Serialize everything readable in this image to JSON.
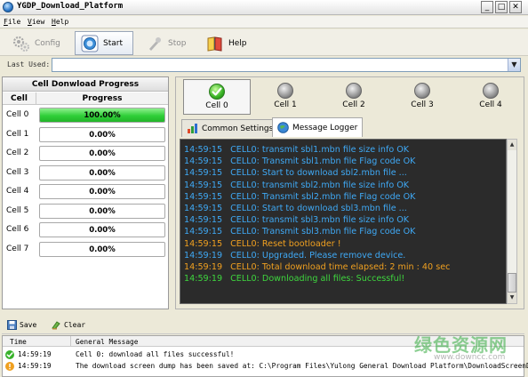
{
  "window": {
    "title": "YGDP_Download_Platform",
    "controls": [
      "_",
      "□",
      "✕"
    ]
  },
  "menu": [
    {
      "label": "File",
      "u": "F",
      "rest": "ile"
    },
    {
      "label": "View",
      "u": "V",
      "rest": "iew"
    },
    {
      "label": "Help",
      "u": "H",
      "rest": "elp"
    }
  ],
  "toolbar": {
    "config_label": "Config",
    "start_label": "Start",
    "stop_label": "Stop",
    "help_label": "Help"
  },
  "last_used": {
    "label": "Last Used:",
    "value": ""
  },
  "progress_panel": {
    "title": "Cell Donwload Progress",
    "col_cell": "Cell",
    "col_progress": "Progress",
    "rows": [
      {
        "cell": "Cell 0",
        "progress": "100.00%",
        "fraction": 1.0
      },
      {
        "cell": "Cell 1",
        "progress": "0.00%",
        "fraction": 0
      },
      {
        "cell": "Cell 2",
        "progress": "0.00%",
        "fraction": 0
      },
      {
        "cell": "Cell 3",
        "progress": "0.00%",
        "fraction": 0
      },
      {
        "cell": "Cell 4",
        "progress": "0.00%",
        "fraction": 0
      },
      {
        "cell": "Cell 5",
        "progress": "0.00%",
        "fraction": 0
      },
      {
        "cell": "Cell 6",
        "progress": "0.00%",
        "fraction": 0
      },
      {
        "cell": "Cell 7",
        "progress": "0.00%",
        "fraction": 0
      }
    ]
  },
  "cell_indicators": [
    {
      "label": "Cell 0",
      "state": "ok"
    },
    {
      "label": "Cell 1",
      "state": "idle"
    },
    {
      "label": "Cell 2",
      "state": "idle"
    },
    {
      "label": "Cell 3",
      "state": "idle"
    },
    {
      "label": "Cell 4",
      "state": "idle"
    }
  ],
  "tabs": {
    "common_settings": "Common Settings",
    "message_logger": "Message Logger"
  },
  "log": {
    "colors": {
      "info": "#3fa9f5",
      "warn": "#f0a020",
      "success": "#3ed63e"
    },
    "lines": [
      {
        "time": "14:59:15",
        "text": "CELL0: transmit sbl1.mbn file size info OK",
        "level": "info"
      },
      {
        "time": "14:59:15",
        "text": "CELL0:  Transmit sbl1.mbn file Flag code OK",
        "level": "info"
      },
      {
        "time": "14:59:15",
        "text": "CELL0:  Start to download sbl2.mbn file ...",
        "level": "info"
      },
      {
        "time": "14:59:15",
        "text": "CELL0: transmit sbl2.mbn file size info OK",
        "level": "info"
      },
      {
        "time": "14:59:15",
        "text": "CELL0:  Transmit sbl2.mbn file Flag code OK",
        "level": "info"
      },
      {
        "time": "14:59:15",
        "text": "CELL0:  Start to download sbl3.mbn file ...",
        "level": "info"
      },
      {
        "time": "14:59:15",
        "text": "CELL0: transmit sbl3.mbn file size info OK",
        "level": "info"
      },
      {
        "time": "14:59:15",
        "text": "CELL0:  Transmit sbl3.mbn file Flag code OK",
        "level": "info"
      },
      {
        "time": "14:59:15",
        "text": "CELL0:  Reset bootloader !",
        "level": "warn"
      },
      {
        "time": "14:59:19",
        "text": "CELL0: Upgraded. Please remove device.",
        "level": "info"
      },
      {
        "time": "14:59:19",
        "text": "CELL0: Total download time elapsed: 2 min : 40 sec",
        "level": "warn"
      },
      {
        "time": "14:59:19",
        "text": "CELL0: Downloading all files: Successful!",
        "level": "success"
      }
    ]
  },
  "bottom": {
    "save_label": "Save",
    "clear_label": "Clear",
    "col_time": "Time",
    "col_message": "General Message",
    "rows": [
      {
        "time": "14:59:19",
        "message": "Cell 0: download all files successful!",
        "status": "success"
      },
      {
        "time": "14:59:19",
        "message": "The download screen dump has been saved at: C:\\Program Files\\Yulong General Download Platform\\DownloadScreenDum",
        "status": "warning"
      }
    ]
  },
  "watermark": {
    "cn": "绿色资源网",
    "url": "www.downcc.com"
  }
}
